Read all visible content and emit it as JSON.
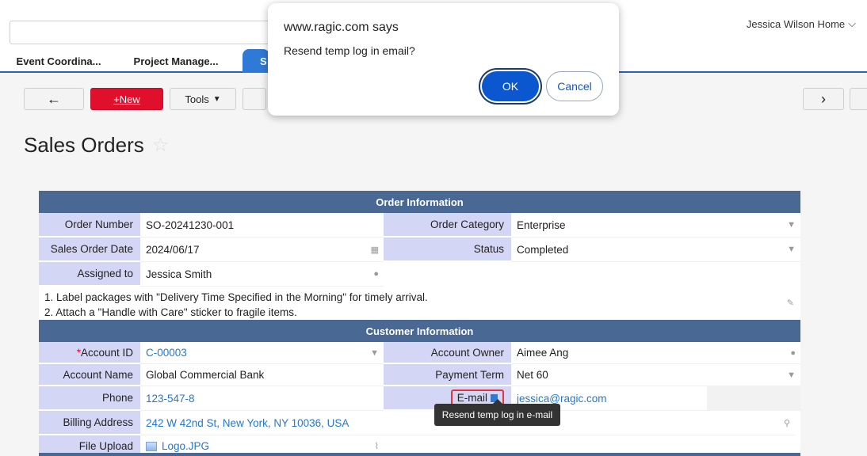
{
  "header": {
    "user_menu": "Jessica Wilson Home",
    "tabs": [
      {
        "label": "Event Coordina..."
      },
      {
        "label": "Project Manage..."
      },
      {
        "label": "S"
      }
    ]
  },
  "toolbar": {
    "back_label": "←",
    "new_label": "+New",
    "tools_label": "Tools",
    "next_label": "›"
  },
  "page": {
    "title": "Sales Orders"
  },
  "order_info": {
    "heading": "Order Information",
    "order_number_label": "Order Number",
    "order_number": "SO-20241230-001",
    "order_category_label": "Order Category",
    "order_category": "Enterprise",
    "sales_order_date_label": "Sales Order Date",
    "sales_order_date": "2024/06/17",
    "status_label": "Status",
    "status": "Completed",
    "assigned_to_label": "Assigned to",
    "assigned_to": "Jessica Smith",
    "notes_line1": "1. Label packages with \"Delivery Time Specified in the Morning\" for timely arrival.",
    "notes_line2": "2. Attach a \"Handle with Care\" sticker to fragile items."
  },
  "customer_info": {
    "heading": "Customer Information",
    "account_id_label": "Account ID",
    "account_id_required": "*",
    "account_id": "C-00003",
    "account_owner_label": "Account Owner",
    "account_owner": "Aimee Ang",
    "account_name_label": "Account Name",
    "account_name": "Global Commercial Bank",
    "payment_term_label": "Payment Term",
    "payment_term": "Net 60",
    "phone_label": "Phone",
    "phone": "123-547-8",
    "email_label": "E-mail",
    "email": "jessica@ragic.com",
    "billing_address_label": "Billing Address",
    "billing_address": "242 W 42nd St, New York, NY 10036, USA",
    "file_upload_label": "File Upload",
    "file_upload": "Logo.JPG"
  },
  "tooltip": {
    "text": "Resend temp log in e-mail"
  },
  "dialog": {
    "title": "www.ragic.com says",
    "message": "Resend temp log in email?",
    "ok_label": "OK",
    "cancel_label": "Cancel"
  }
}
